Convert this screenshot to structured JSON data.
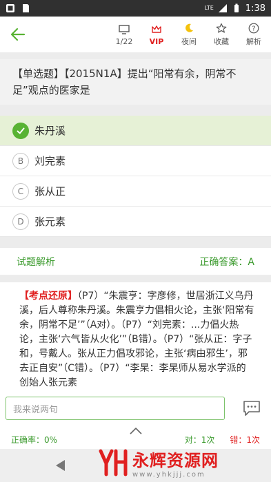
{
  "status_bar": {
    "network": "LTE",
    "time": "1:38"
  },
  "header": {
    "back_label": "",
    "tools": [
      {
        "label": "1/22",
        "icon": "screen-icon"
      },
      {
        "label": "VIP",
        "icon": "crown-icon"
      },
      {
        "label": "夜间",
        "icon": "moon-icon"
      },
      {
        "label": "收藏",
        "icon": "star-icon"
      },
      {
        "label": "解析",
        "icon": "help-icon"
      }
    ]
  },
  "question": {
    "text": "【单选题】【2015N1A】提出“阳常有余，阴常不足”观点的医家是"
  },
  "options": [
    {
      "letter": "A",
      "text": "朱丹溪",
      "correct": true
    },
    {
      "letter": "B",
      "text": "刘完素",
      "correct": false
    },
    {
      "letter": "C",
      "text": "张从正",
      "correct": false
    },
    {
      "letter": "D",
      "text": "张元素",
      "correct": false
    }
  ],
  "analysis": {
    "title": "试题解析",
    "answer_label": "正确答案：A",
    "tag": "【考点还原】",
    "body": "（P7）“朱震亨：字彦修，世居浙江义乌丹溪，后人尊称朱丹溪。朱震亨力倡相火论，主张‘阳常有余，阴常不足’”（A对）。（P7）“刘完素：...力倡火热论，主张‘六气皆从火化’”（B错）。（P7）“张从正：字子和，号戴人。张从正力倡攻邪论，主张‘病由邪生’，邪去正自安”（C错）。（P7）“李杲：李杲师从易水学派的创始人张元素"
  },
  "comment": {
    "placeholder": "我来说两句"
  },
  "stats": {
    "accuracy": "正确率：0%",
    "correct": "对：1次",
    "wrong": "错：1次"
  },
  "watermark": {
    "title": "永辉资源网",
    "url": "www.yhkjjj.com"
  },
  "colors": {
    "accent": "#58b333",
    "green_text": "#3a9a2c",
    "red": "#e02020"
  }
}
